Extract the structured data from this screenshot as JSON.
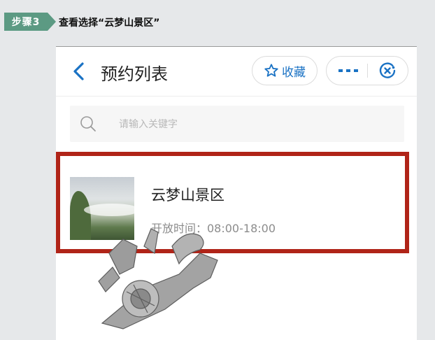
{
  "step": {
    "label": "步骤3",
    "text": "查看选择“云梦山景区”"
  },
  "nav": {
    "title": "预约列表",
    "fav_label": "收藏"
  },
  "search": {
    "placeholder": "请输入关键字"
  },
  "items": [
    {
      "name": "云梦山景区",
      "time": "开放时间：08:00-18:00"
    }
  ],
  "colors": {
    "accent": "#1a72c4",
    "highlight": "#b02418",
    "step_tag": "#5c9a83"
  },
  "icons": [
    "back-arrow-icon",
    "star-icon",
    "more-dots-icon",
    "close-circle-icon",
    "search-icon"
  ]
}
